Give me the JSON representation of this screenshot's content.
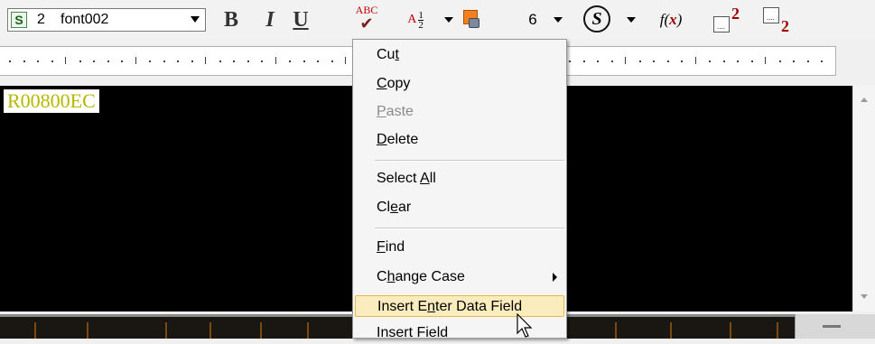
{
  "toolbar": {
    "font_number": "2",
    "font_name": "font002",
    "bold_label": "B",
    "italic_label": "I",
    "underline_label": "U",
    "spell_abc": "ABC",
    "spell_check": "✔",
    "fraction_letter": "A",
    "fraction_num": "1",
    "fraction_den": "2",
    "size_value": "6",
    "symbol_label": "S",
    "fx_f": "f",
    "fx_paren_open": "(",
    "fx_x": "x",
    "fx_paren_close": ")",
    "superscript_value": "2",
    "subscript_value": "2",
    "box_dots": "....",
    "colors": {
      "accent_red": "#c00000",
      "dark_red": "#9c0000",
      "orange": "#f08020"
    }
  },
  "editor": {
    "text": "R00800EC",
    "background": "#000000",
    "text_color": "#b5b800"
  },
  "context_menu": {
    "cut": {
      "pre": "Cu",
      "key": "t",
      "post": ""
    },
    "copy": {
      "pre": "",
      "key": "C",
      "post": "opy"
    },
    "paste": {
      "pre": "",
      "key": "P",
      "post": "aste"
    },
    "delete": {
      "pre": "",
      "key": "D",
      "post": "elete"
    },
    "select_all": {
      "pre": "Select ",
      "key": "A",
      "post": "ll"
    },
    "clear": {
      "pre": "Cl",
      "key": "e",
      "post": "ar"
    },
    "find": {
      "pre": "",
      "key": "F",
      "post": "ind"
    },
    "change_case": {
      "pre": "C",
      "key": "h",
      "post": "ange Case"
    },
    "insert_enter_data_field": {
      "pre": "Insert E",
      "key": "n",
      "post": "ter Data Field"
    },
    "insert_field": {
      "pre": "Insert Field",
      "key": "",
      "post": ""
    }
  }
}
